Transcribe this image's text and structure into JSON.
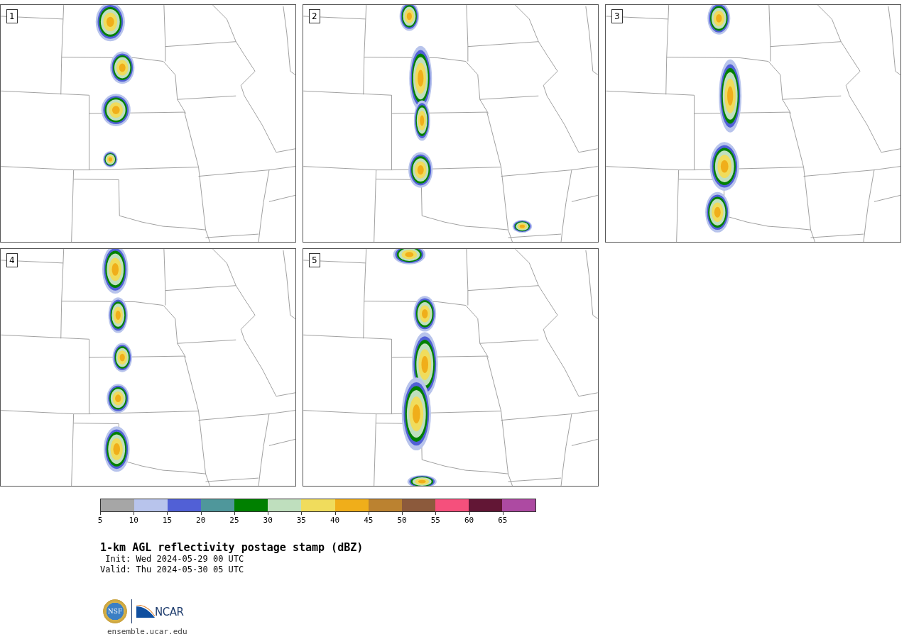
{
  "panels": [
    {
      "label": "1"
    },
    {
      "label": "2"
    },
    {
      "label": "3"
    },
    {
      "label": "4"
    },
    {
      "label": "5"
    }
  ],
  "colorbar": {
    "bins": [
      {
        "color": "#a6a6a6"
      },
      {
        "color": "#b8c4ec"
      },
      {
        "color": "#5160d6"
      },
      {
        "color": "#4f979b"
      },
      {
        "color": "#008000"
      },
      {
        "color": "#bfdfbe"
      },
      {
        "color": "#f0dc5c"
      },
      {
        "color": "#f0ae1a"
      },
      {
        "color": "#bb8230"
      },
      {
        "color": "#8c5a3c"
      },
      {
        "color": "#f5507c"
      },
      {
        "color": "#621635"
      },
      {
        "color": "#ad4aa2"
      }
    ],
    "ticks": [
      "5",
      "10",
      "15",
      "20",
      "25",
      "30",
      "35",
      "40",
      "45",
      "50",
      "55",
      "60",
      "65"
    ]
  },
  "title": "1-km AGL reflectivity postage stamp (dBZ)",
  "init": " Init: Wed 2024-05-29 00 UTC",
  "valid": "Valid: Thu 2024-05-30 05 UTC",
  "logo": {
    "nsf_text": "NSF",
    "ncar_text": "NCAR"
  },
  "website": "ensemble.ucar.edu"
}
